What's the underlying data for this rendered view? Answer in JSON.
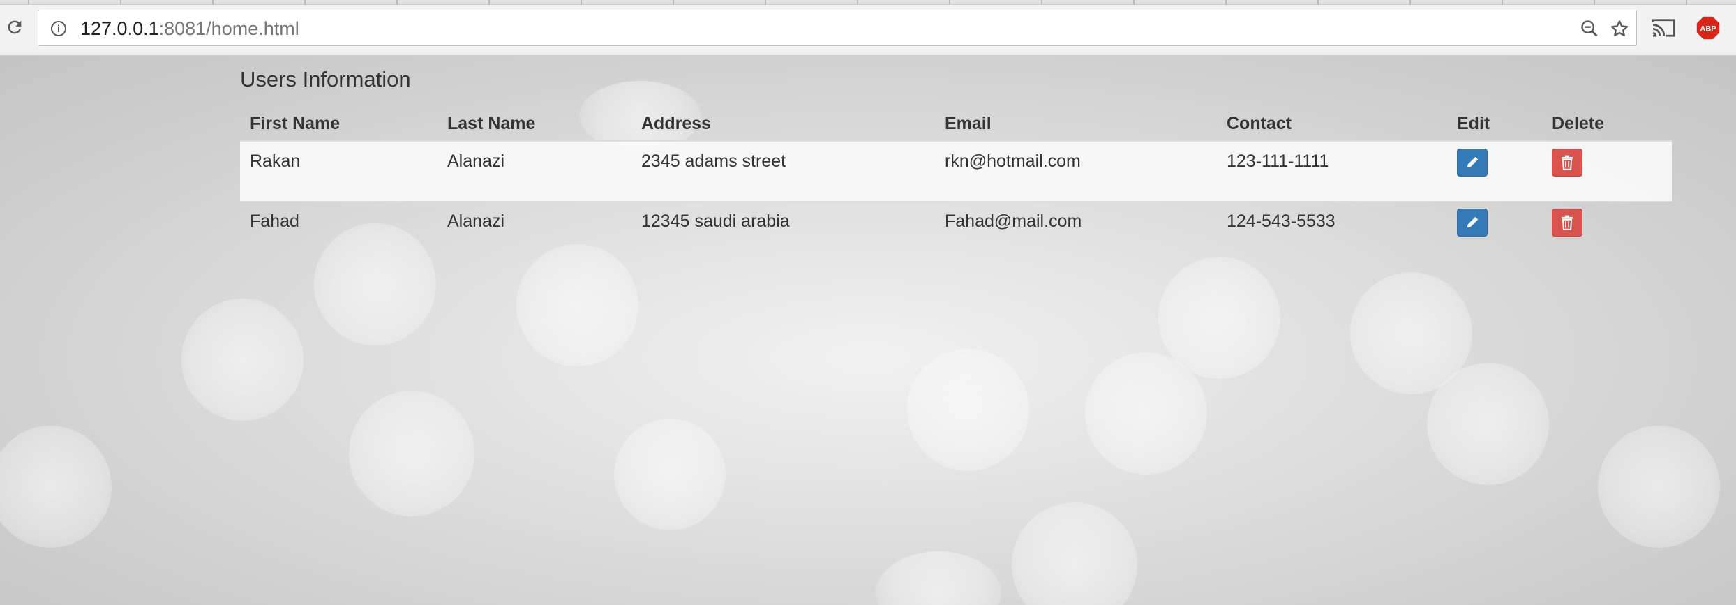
{
  "browser": {
    "url_host": "127.0.0.1",
    "url_rest": ":8081/home.html",
    "icons": {
      "reload": "reload-icon",
      "info": "info-icon",
      "zoom": "zoom-out-icon",
      "bookmark": "star-icon",
      "cast": "cast-icon",
      "adblock": "adblock-plus-icon"
    },
    "adblock_label": "ABP"
  },
  "page": {
    "title": "Users Information",
    "table": {
      "headers": {
        "first_name": "First Name",
        "last_name": "Last Name",
        "address": "Address",
        "email": "Email",
        "contact": "Contact",
        "edit": "Edit",
        "delete": "Delete"
      },
      "rows": [
        {
          "first_name": "Rakan",
          "last_name": "Alanazi",
          "address": "2345 adams street",
          "email": "rkn@hotmail.com",
          "contact": "123-111-1111"
        },
        {
          "first_name": "Fahad",
          "last_name": "Alanazi",
          "address": "12345 saudi arabia",
          "email": "Fahad@mail.com",
          "contact": "124-543-5533"
        }
      ]
    }
  },
  "colors": {
    "edit_button": "#337ab7",
    "delete_button": "#d9534f",
    "adblock_red": "#d9261c"
  }
}
